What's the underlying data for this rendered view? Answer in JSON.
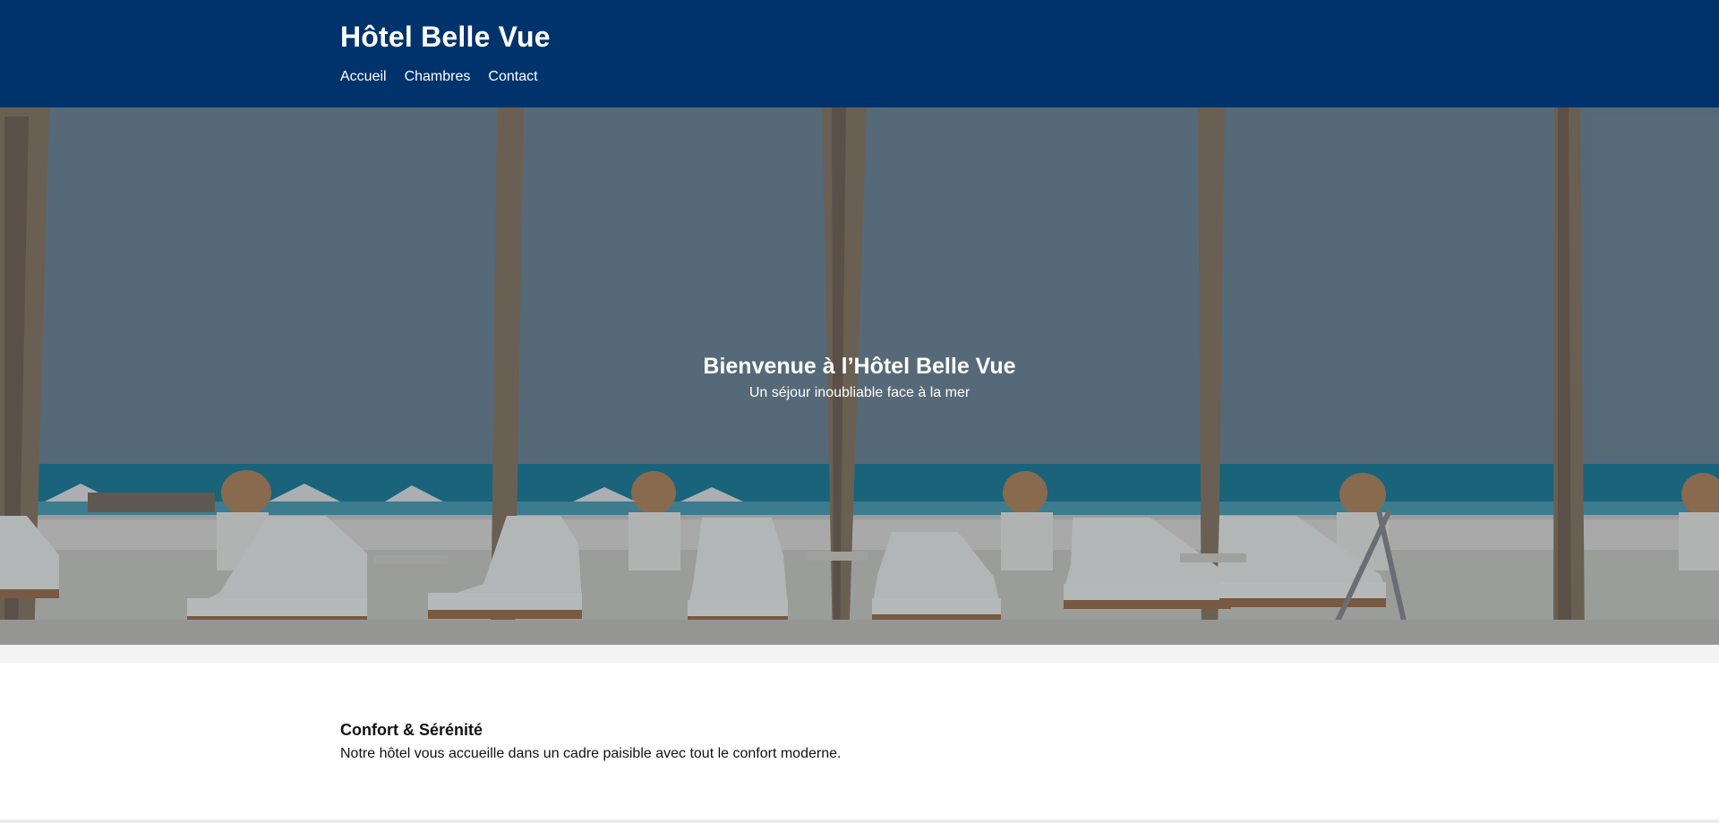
{
  "header": {
    "title": "Hôtel Belle Vue",
    "nav": [
      {
        "label": "Accueil"
      },
      {
        "label": "Chambres"
      },
      {
        "label": "Contact"
      }
    ]
  },
  "hero": {
    "title": "Bienvenue à l’Hôtel Belle Vue",
    "subtitle": "Un séjour inoubliable face à la mer"
  },
  "content": {
    "section_title": "Confort & Sérénité",
    "section_text": "Notre hôtel vous accueille dans un cadre paisible avec tout le confort moderne."
  },
  "colors": {
    "header_bg": "#00336b",
    "hero_text": "#ffffff",
    "body_text": "#111111"
  }
}
